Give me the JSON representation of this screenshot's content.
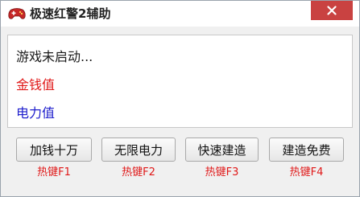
{
  "window": {
    "title": "极速红警2辅助",
    "icon": "gamepad-icon",
    "close_label": "×"
  },
  "info": {
    "status": "游戏未启动...",
    "money_label": "金钱值",
    "power_label": "电力值"
  },
  "buttons": [
    {
      "label": "加钱十万",
      "hotkey": "热键F1"
    },
    {
      "label": "无限电力",
      "hotkey": "热键F2"
    },
    {
      "label": "快速建造",
      "hotkey": "热键F3"
    },
    {
      "label": "建造免费",
      "hotkey": "热键F4"
    }
  ],
  "colors": {
    "close_bg": "#c94241",
    "money_text": "#e01818",
    "power_text": "#1c1ccc",
    "hotkey_text": "#e01818"
  }
}
